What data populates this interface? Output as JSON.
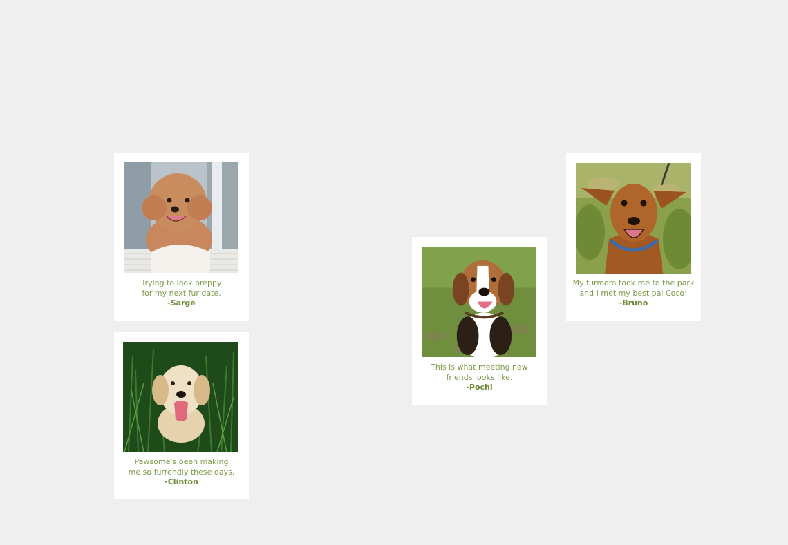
{
  "cards": [
    {
      "photo_subject": "toy poodle",
      "caption_line1": "Trying to look preppy",
      "caption_line2": "for my next fur date.",
      "author": "-Sarge"
    },
    {
      "photo_subject": "golden retriever",
      "caption_line1": "Pawsome's been making",
      "caption_line2": "me so furrendly these days.",
      "author": "-Clinton"
    },
    {
      "photo_subject": "beagle",
      "caption_line1": "This is what meeting new",
      "caption_line2": "friends looks like.",
      "author": "-Pochi"
    },
    {
      "photo_subject": "miniature pinscher",
      "caption_line1": "My furmom took me to the park",
      "caption_line2": "and I met my best pal Coco!",
      "author": "-Bruno"
    }
  ],
  "colors": {
    "background": "#efefef",
    "card": "#ffffff",
    "caption_text": "#7d9a4a"
  }
}
